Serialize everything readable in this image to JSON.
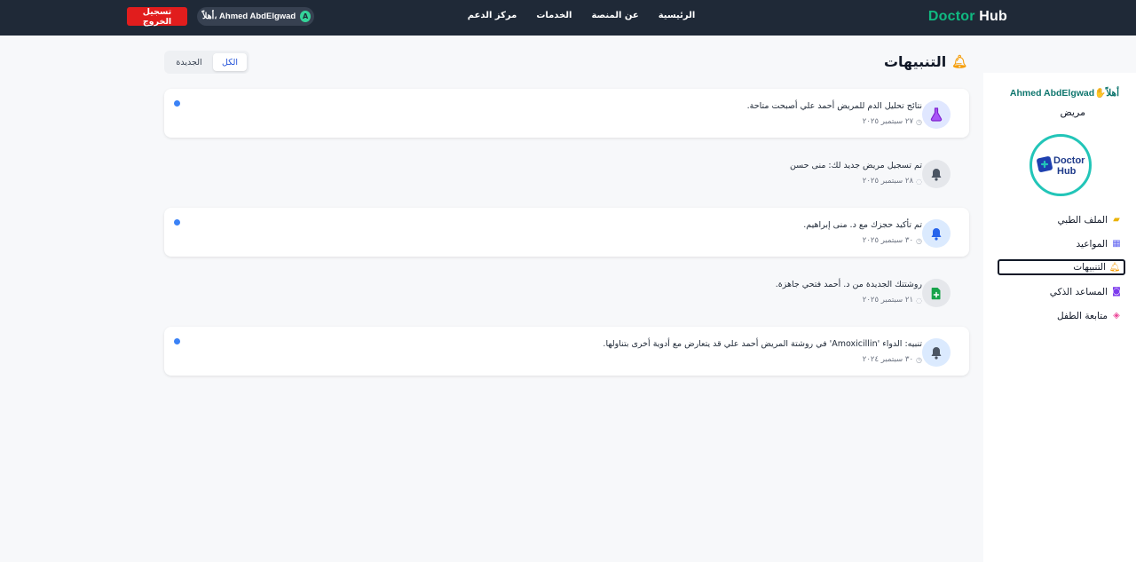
{
  "topbar": {
    "brand_part1": "Doctor",
    "brand_part2": "Hub",
    "nav": [
      "الرئيسية",
      "عن المنصة",
      "الخدمات",
      "مركز الدعم"
    ],
    "greeting": "أهلاً، Ahmed AbdElgwad",
    "avatar_initial": "A",
    "logout_label": "تسجيل الخروج"
  },
  "sidebar": {
    "greeting_prefix": "أهلاً",
    "user_name": "Ahmed AbdElgwad",
    "role": "مريض",
    "logo_line1": "Doctor",
    "logo_line2": "Hub",
    "items": [
      {
        "label": "الملف الطبي",
        "icon": "folder-icon"
      },
      {
        "label": "المواعيد",
        "icon": "calendar-icon"
      },
      {
        "label": "التنبيهات",
        "icon": "bell-icon"
      },
      {
        "label": "المساعد الذكي",
        "icon": "robot-icon"
      },
      {
        "label": "متابعة الطفل",
        "icon": "pacifier-icon"
      }
    ]
  },
  "main": {
    "title": "التنبيهات",
    "tab_all": "الكل",
    "tab_new": "الجديدة"
  },
  "notifications": [
    {
      "text": "نتائج تحليل الدم للمريض أحمد علي أصبحت متاحة.",
      "time": "٢٧ سبتمبر ٢٠٢٥",
      "icon": "flask-icon",
      "unread": true
    },
    {
      "text": "تم تسجيل مريض جديد لك: منى حسن",
      "time": "٢٨ سبتمبر ٢٠٢٥",
      "icon": "bell-icon",
      "unread": false
    },
    {
      "text": "تم تأكيد حجزك مع د. منى إبراهيم.",
      "time": "٣٠ سبتمبر ٢٠٢٥",
      "icon": "bell-icon",
      "unread": true
    },
    {
      "text": "روشتتك الجديدة من د. أحمد فتحي جاهزة.",
      "time": "٢١ سبتمبر ٢٠٢٥",
      "icon": "prescription-icon",
      "unread": false
    },
    {
      "text": "تنبيه: الدواء 'Amoxicillin' في روشتة المريض أحمد علي قد يتعارض مع أدوية أخرى بتناولها.",
      "time": "٣٠ سبتمبر ٢٠٢٤",
      "icon": "bell-icon",
      "unread": true
    }
  ],
  "colors": {
    "topbar": "#1f2937",
    "brand_green": "#10b981",
    "logout_red": "#e11d1d",
    "unread_dot": "#3b82f6",
    "logo_ring": "#22c5b8"
  }
}
